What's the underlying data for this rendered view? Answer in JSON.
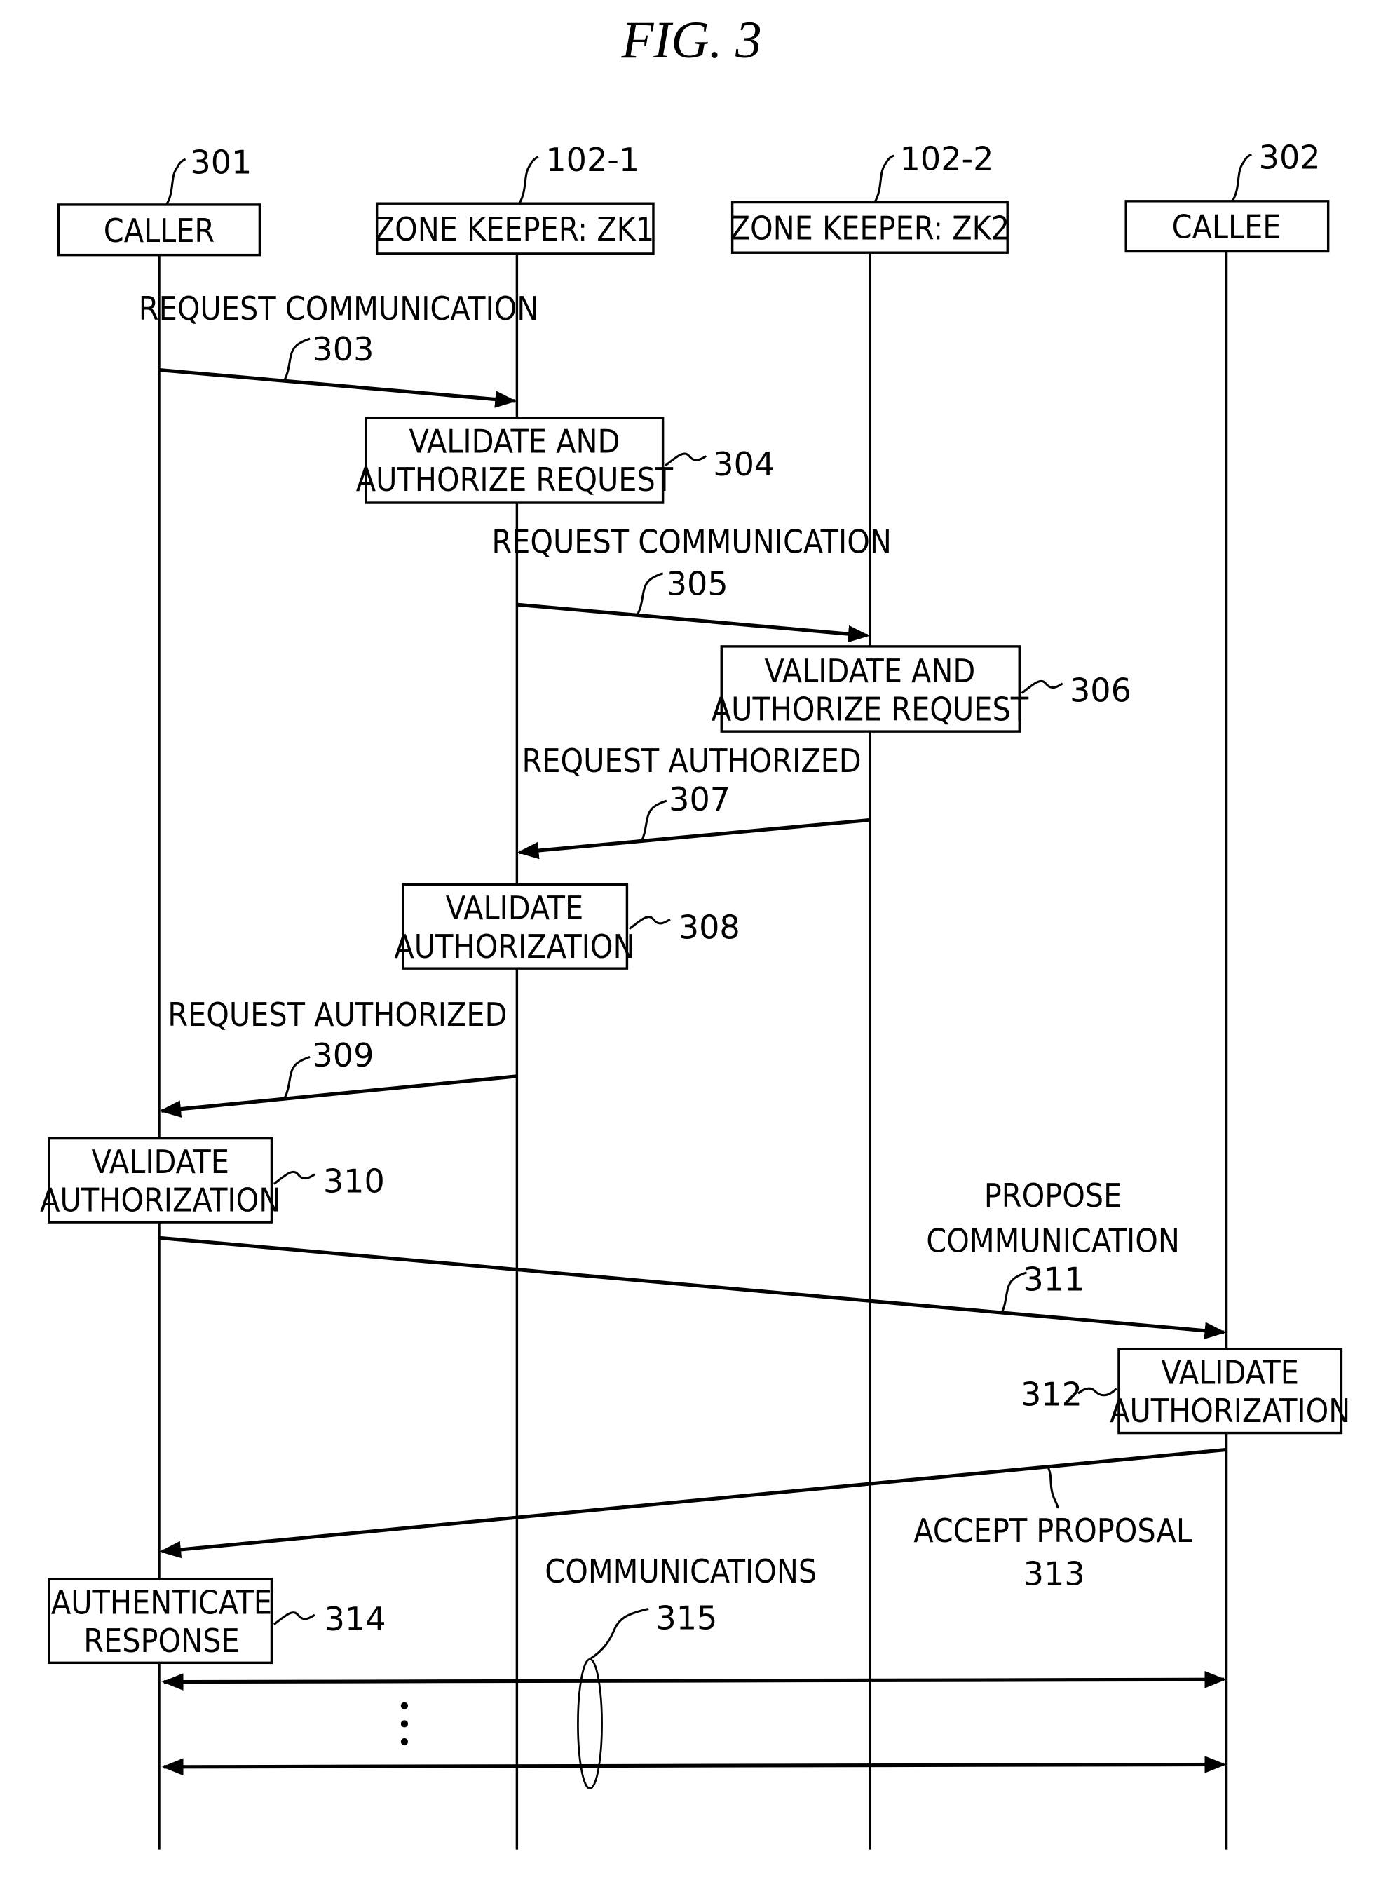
{
  "figure": {
    "title": "FIG. 3"
  },
  "participants": [
    {
      "id": "caller",
      "label": "CALLER",
      "ref": "301"
    },
    {
      "id": "zk1",
      "label": "ZONE KEEPER: ZK1",
      "ref": "102-1"
    },
    {
      "id": "zk2",
      "label": "ZONE KEEPER: ZK2",
      "ref": "102-2"
    },
    {
      "id": "callee",
      "label": "CALLEE",
      "ref": "302"
    }
  ],
  "steps": [
    {
      "ref": "303",
      "type": "message",
      "from": "caller",
      "to": "zk1",
      "lines": [
        "REQUEST COMMUNICATION"
      ]
    },
    {
      "ref": "304",
      "type": "process",
      "on": "zk1",
      "lines": [
        "VALIDATE AND",
        "AUTHORIZE REQUEST"
      ]
    },
    {
      "ref": "305",
      "type": "message",
      "from": "zk1",
      "to": "zk2",
      "lines": [
        "REQUEST COMMUNICATION"
      ]
    },
    {
      "ref": "306",
      "type": "process",
      "on": "zk2",
      "lines": [
        "VALIDATE AND",
        "AUTHORIZE REQUEST"
      ]
    },
    {
      "ref": "307",
      "type": "message",
      "from": "zk2",
      "to": "zk1",
      "lines": [
        "REQUEST AUTHORIZED"
      ]
    },
    {
      "ref": "308",
      "type": "process",
      "on": "zk1",
      "lines": [
        "VALIDATE",
        "AUTHORIZATION"
      ]
    },
    {
      "ref": "309",
      "type": "message",
      "from": "zk1",
      "to": "caller",
      "lines": [
        "REQUEST AUTHORIZED"
      ]
    },
    {
      "ref": "310",
      "type": "process",
      "on": "caller",
      "lines": [
        "VALIDATE",
        "AUTHORIZATION"
      ]
    },
    {
      "ref": "311",
      "type": "message",
      "from": "caller",
      "to": "callee",
      "lines": [
        "PROPOSE",
        "COMMUNICATION"
      ]
    },
    {
      "ref": "312",
      "type": "process",
      "on": "callee",
      "lines": [
        "VALIDATE",
        "AUTHORIZATION"
      ]
    },
    {
      "ref": "313",
      "type": "message",
      "from": "callee",
      "to": "caller",
      "lines": [
        "ACCEPT PROPOSAL"
      ]
    },
    {
      "ref": "314",
      "type": "process",
      "on": "caller",
      "lines": [
        "AUTHENTICATE",
        "RESPONSE"
      ]
    },
    {
      "ref": "315",
      "type": "bidirectional",
      "between": [
        "caller",
        "callee"
      ],
      "lines": [
        "COMMUNICATIONS"
      ],
      "ellipsis": "⋮"
    }
  ]
}
